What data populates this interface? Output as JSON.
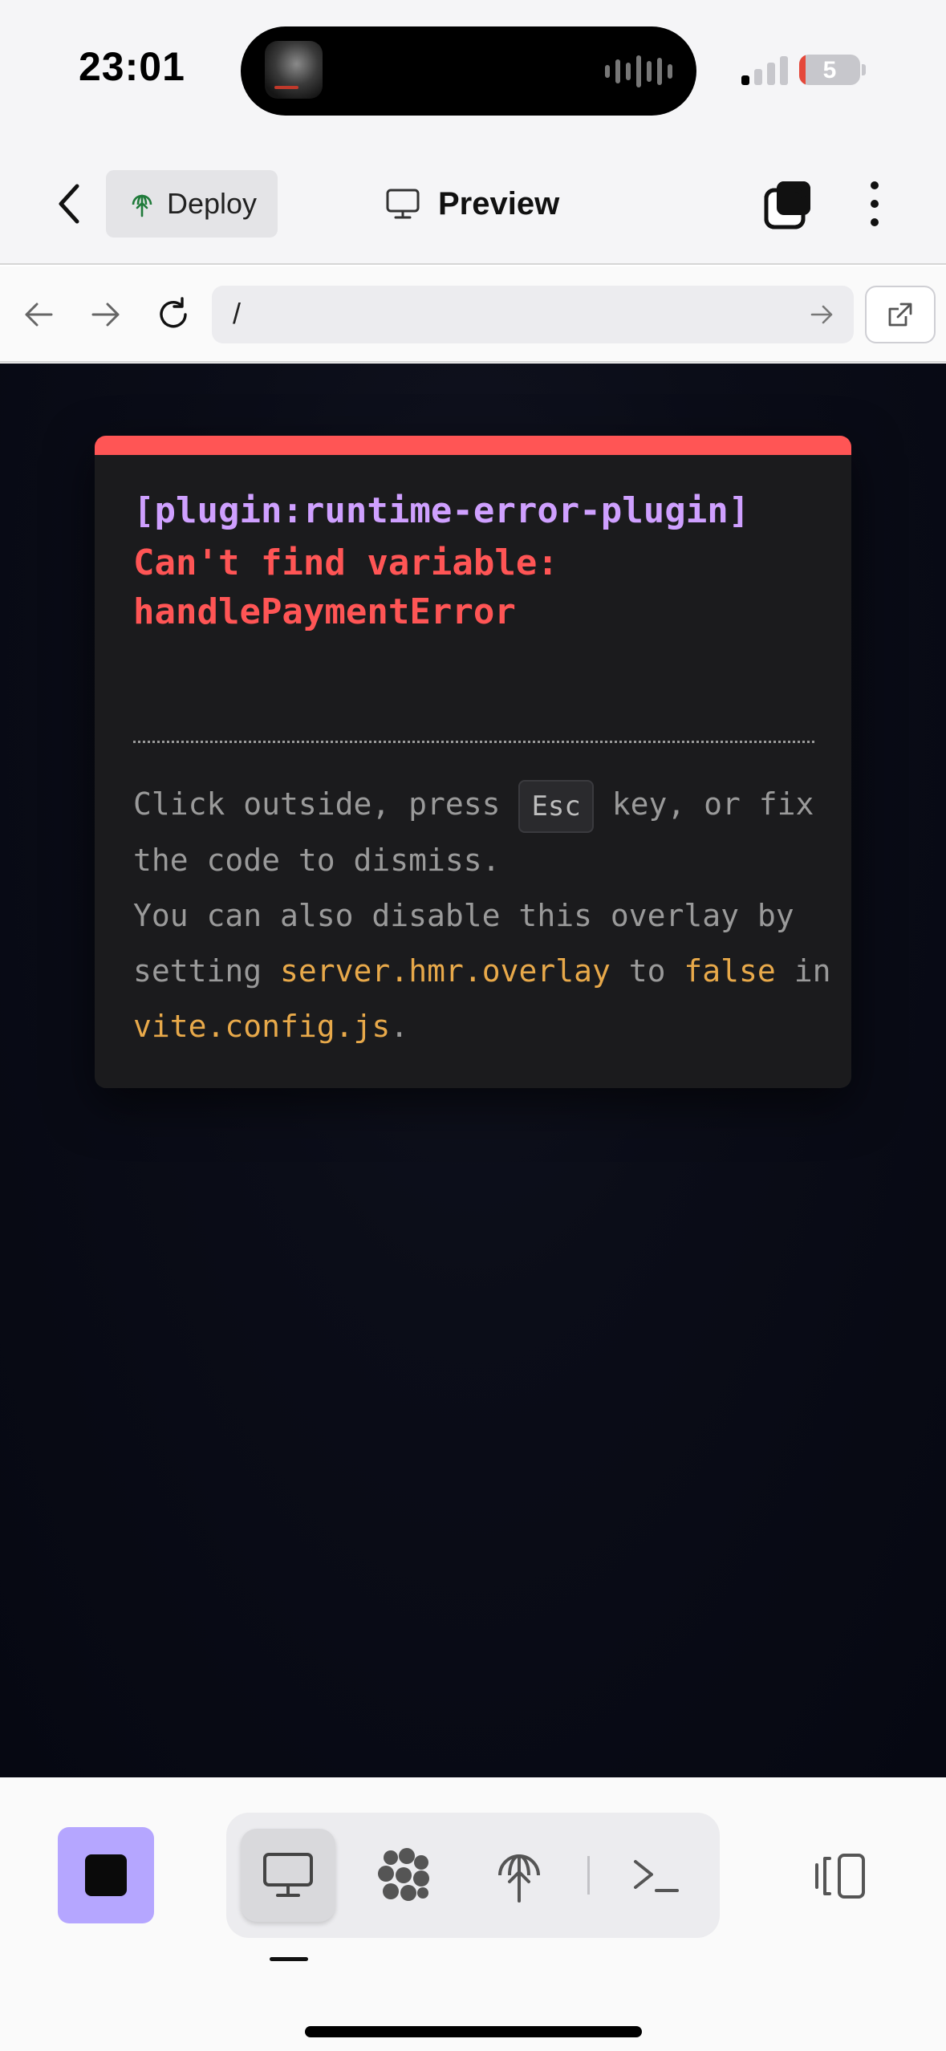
{
  "status_bar": {
    "time": "23:01",
    "battery_level": "5"
  },
  "header": {
    "deploy_label": "Deploy",
    "title": "Preview"
  },
  "browser": {
    "url": "/"
  },
  "error_overlay": {
    "plugin": "[plugin:runtime-error-plugin]",
    "message": "Can't find variable:\nhandlePaymentError",
    "tip_1": "Click outside, press",
    "tip_key": "Esc",
    "tip_2": "key, or fix the code to dismiss.",
    "tip_3": "You can also disable this overlay by setting",
    "tip_code_1": "server.hmr.overlay",
    "tip_4": "to",
    "tip_code_2": "false",
    "tip_5": "in",
    "tip_code_3": "vite.config.js",
    "tip_6": ".",
    "accent_color": "#ff5555",
    "plugin_color": "#cfa0ff",
    "code_color": "#e8a94a"
  },
  "toolbar": {
    "stop_color": "#b5a6ff",
    "tools": [
      "monitor-icon",
      "agent-icon",
      "deploy-icon",
      "shell-icon"
    ],
    "active_tool": "monitor-icon"
  }
}
